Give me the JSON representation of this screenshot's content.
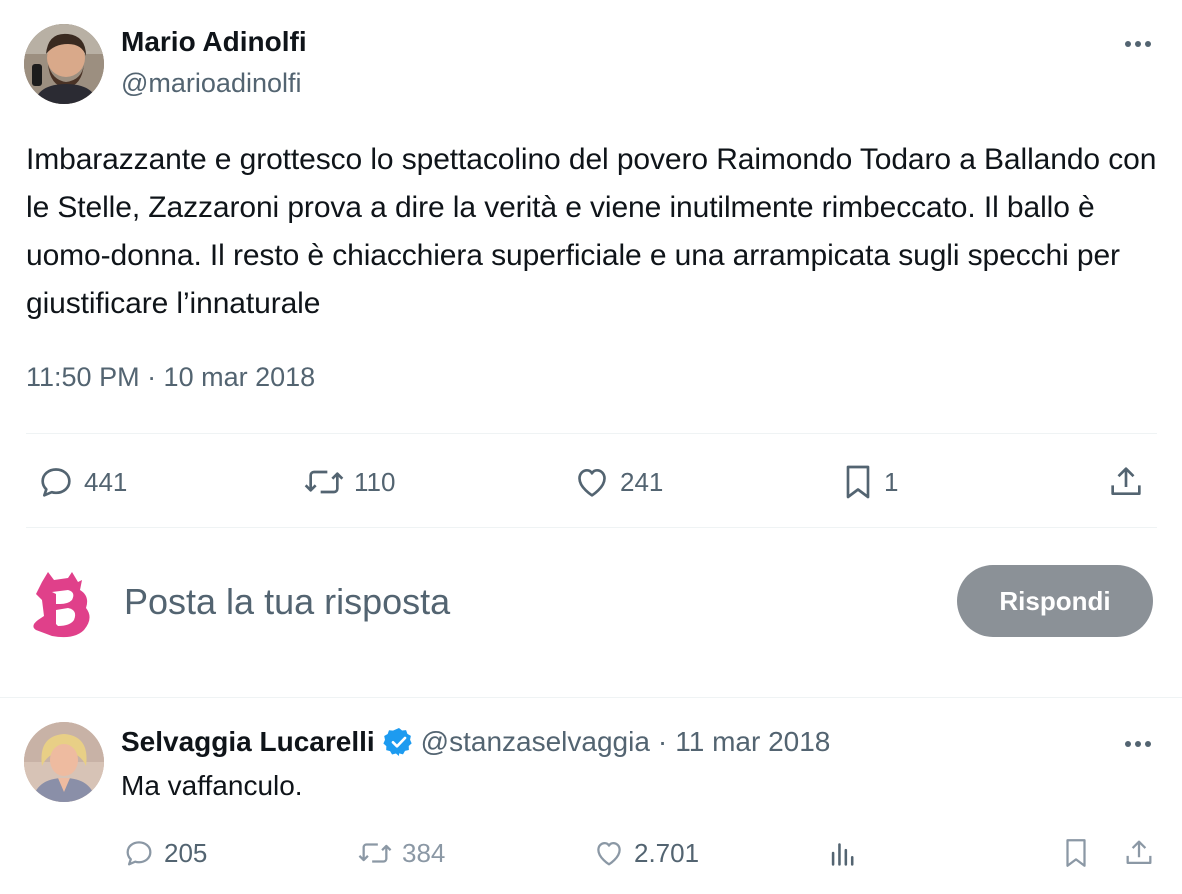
{
  "tweet": {
    "author_name": "Mario Adinolfi",
    "author_handle": "@marioadinolfi",
    "text": "Imbarazzante e grottesco lo spettacolino del povero Raimondo Todaro a Ballando con le Stelle, Zazzaroni prova a dire la verità e viene inutilmente rimbeccato. Il ballo è uomo-donna. Il resto è chiacchiera superficiale e una arrampicata sugli specchi per giustificare l’innaturale",
    "timestamp": "11:50 PM · 10 mar 2018",
    "more_icon": "more-horizontal-icon",
    "actions": {
      "replies": "441",
      "reposts": "110",
      "likes": "241",
      "bookmarks": "1"
    }
  },
  "composer": {
    "placeholder": "Posta la tua risposta",
    "reply_button": "Rispondi",
    "logo_icon": "pink-b-brand-logo"
  },
  "reply": {
    "author_name": "Selvaggia Lucarelli",
    "verified_icon": "verified-badge-icon",
    "author_handle": "@stanzaselvaggia",
    "separator": "·",
    "date": "11 mar 2018",
    "text": "Ma vaffanculo.",
    "actions": {
      "replies": "205",
      "reposts": "384",
      "likes": "2.701"
    }
  },
  "colors": {
    "text": "#0f1419",
    "muted": "#536471",
    "divider": "#eff3f4",
    "verified": "#1d9bf0",
    "button_disabled": "#8b9197",
    "brand_pink": "#e0408a"
  }
}
